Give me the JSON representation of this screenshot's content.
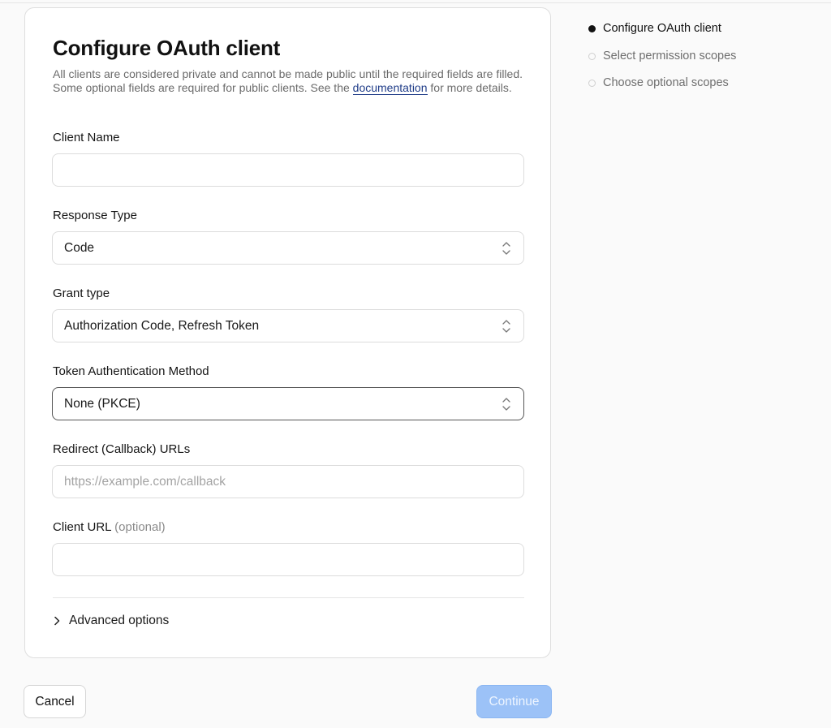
{
  "form": {
    "title": "Configure OAuth client",
    "description_before": "All clients are considered private and cannot be made public until the required fields are filled. Some optional fields are required for public clients. See the ",
    "description_link": "documentation",
    "description_after": " for more details.",
    "fields": {
      "client_name": {
        "label": "Client Name",
        "value": "",
        "placeholder": ""
      },
      "response_type": {
        "label": "Response Type",
        "value": "Code"
      },
      "grant_type": {
        "label": "Grant type",
        "value": "Authorization Code, Refresh Token"
      },
      "token_auth_method": {
        "label": "Token Authentication Method",
        "value": "None (PKCE)"
      },
      "redirect_urls": {
        "label": "Redirect (Callback) URLs",
        "value": "",
        "placeholder": "https://example.com/callback"
      },
      "client_url": {
        "label": "Client URL",
        "label_suffix": "(optional)",
        "value": "",
        "placeholder": ""
      }
    },
    "advanced_options_label": "Advanced options"
  },
  "actions": {
    "cancel_label": "Cancel",
    "continue_label": "Continue"
  },
  "steps": [
    {
      "label": "Configure OAuth client",
      "state": "active"
    },
    {
      "label": "Select permission scopes",
      "state": "inactive"
    },
    {
      "label": "Choose optional scopes",
      "state": "inactive"
    }
  ],
  "colors": {
    "primary_disabled": "#9cc2f7",
    "link": "#1f3c88",
    "active_step_dot": "#111111"
  },
  "icons": {
    "select_chevron": "chevron-up-down-icon",
    "advanced_toggle": "chevron-right-icon",
    "step_marker": "dot-icon"
  }
}
